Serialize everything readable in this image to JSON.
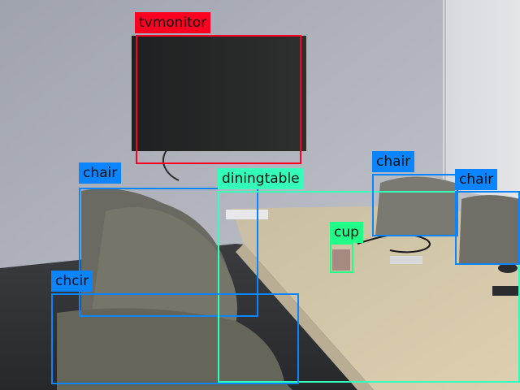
{
  "detections": [
    {
      "label": "tvmonitor",
      "color": "#ff0022"
    },
    {
      "label": "chair",
      "color": "#0a84ff"
    },
    {
      "label": "diningtable",
      "color": "#33ffbb"
    },
    {
      "label": "chair",
      "color": "#0a84ff"
    },
    {
      "label": "chair",
      "color": "#0a84ff"
    },
    {
      "label": "cup",
      "color": "#22ff88"
    },
    {
      "label": "chcir",
      "color": "#0a84ff"
    }
  ]
}
